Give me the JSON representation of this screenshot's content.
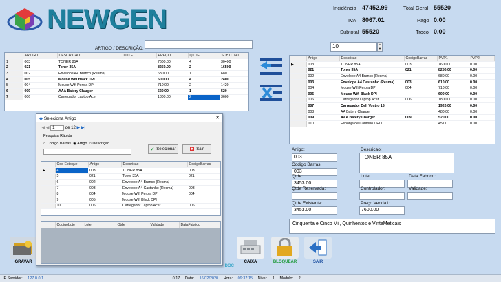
{
  "app": {
    "logo_text": "NEWGEN"
  },
  "summary": {
    "incidencia_label": "Incidência",
    "incidencia_value": "47452.99",
    "iva_label": "IVA",
    "iva_value": "8067.01",
    "subtotal_label": "Subtotal",
    "subtotal_value": "55520",
    "total_geral_label": "Total Geral",
    "total_geral_value": "55520",
    "pago_label": "Pago",
    "pago_value": "0.00",
    "troco_label": "Troco",
    "troco_value": "0.00"
  },
  "search": {
    "label": "ARTIGO / DESCRIÇÃO:",
    "value": ""
  },
  "quantity": {
    "value": "10"
  },
  "cart": {
    "headers": [
      "ARTIGO",
      "DESCRICAO",
      "LOTE",
      "PREÇO",
      "QTDE",
      "SUBTOTAL"
    ],
    "rows": [
      {
        "n": "1",
        "artigo": "003",
        "desc": "TONER 85A",
        "lote": "",
        "preco": "7600.00",
        "qtde": "4",
        "subtotal": "30400",
        "bold": false
      },
      {
        "n": "2",
        "artigo": "021",
        "desc": "Toner 35A",
        "lote": "",
        "preco": "8250.00",
        "qtde": "2",
        "subtotal": "16500",
        "bold": true
      },
      {
        "n": "3",
        "artigo": "002",
        "desc": "Envelope A4 Branco (Resma)",
        "lote": "",
        "preco": "680.00",
        "qtde": "1",
        "subtotal": "680",
        "bold": false
      },
      {
        "n": "4",
        "artigo": "005",
        "desc": "Mouse Wifi Black DPI",
        "lote": "",
        "preco": "600.00",
        "qtde": "4",
        "subtotal": "2400",
        "bold": true
      },
      {
        "n": "5",
        "artigo": "004",
        "desc": "Mouse Wifi Perola DPI",
        "lote": "",
        "preco": "710.00",
        "qtde": "2",
        "subtotal": "1420",
        "bold": false
      },
      {
        "n": "6",
        "artigo": "009",
        "desc": "AAA Batery Charger",
        "lote": "",
        "preco": "520.00",
        "qtde": "1",
        "subtotal": "520",
        "bold": true
      },
      {
        "n": "7",
        "artigo": "006",
        "desc": "Carregador Laptop Acer",
        "lote": "",
        "preco": "1800.00",
        "qtde": "2",
        "subtotal": "3600",
        "bold": false
      }
    ]
  },
  "catalog": {
    "headers": [
      "Artigo",
      "Descricao",
      "CodigoBarras",
      "PVP1",
      "PVP2"
    ],
    "rows": [
      {
        "artigo": "003",
        "desc": "TONER 85A",
        "cod": "003",
        "pvp1": "7600.00",
        "pvp2": "0.00",
        "bold": false
      },
      {
        "artigo": "021",
        "desc": "Toner 35A",
        "cod": "021",
        "pvp1": "8250.00",
        "pvp2": "0.00",
        "bold": true
      },
      {
        "artigo": "002",
        "desc": "Envelope A4 Branco (Resma)",
        "cod": "",
        "pvp1": "680.00",
        "pvp2": "0.00",
        "bold": false
      },
      {
        "artigo": "003",
        "desc": "Envelope A4 Castanho (Resma)",
        "cod": "003",
        "pvp1": "610.00",
        "pvp2": "0.00",
        "bold": true
      },
      {
        "artigo": "004",
        "desc": "Mouse Wifi Perola DPI",
        "cod": "004",
        "pvp1": "710.00",
        "pvp2": "0.00",
        "bold": false
      },
      {
        "artigo": "005",
        "desc": "Mouse Wifi Black DPI",
        "cod": "",
        "pvp1": "600.00",
        "pvp2": "0.00",
        "bold": true
      },
      {
        "artigo": "006",
        "desc": "Carregador Laptop Acer",
        "cod": "006",
        "pvp1": "1800.00",
        "pvp2": "0.00",
        "bold": false
      },
      {
        "artigo": "007",
        "desc": "Carregador Dell Vostro 15",
        "cod": "",
        "pvp1": "1920.00",
        "pvp2": "0.00",
        "bold": true
      },
      {
        "artigo": "008",
        "desc": "AA Batery Charger",
        "cod": "",
        "pvp1": "480.00",
        "pvp2": "0.00",
        "bold": false
      },
      {
        "artigo": "009",
        "desc": "AAA Batery Charger",
        "cod": "009",
        "pvp1": "520.00",
        "pvp2": "0.00",
        "bold": true
      },
      {
        "artigo": "010",
        "desc": "Esponja de Carimbo DELI",
        "cod": "",
        "pvp1": "45.00",
        "pvp2": "0.00",
        "bold": false
      }
    ]
  },
  "details": {
    "artigo_label": "Artigo:",
    "artigo_value": "003",
    "codbarras_label": "Codigo Barras:",
    "codbarras_value": "003",
    "qtde_label": "Qtde:",
    "qtde_value": "3453.00",
    "qtde_reservada_label": "Qtde Reservada:",
    "qtde_reservada_value": "",
    "qtde_existente_label": "Qtde Existente:",
    "qtde_existente_value": "3453.00",
    "descricao_label": "Descricao:",
    "descricao_value": "TONER 85A",
    "lote_label": "Lote:",
    "lote_value": "",
    "data_fabrico_label": "Data Fabrico:",
    "data_fabrico_value": "",
    "controlador_label": "Controlador:",
    "controlador_value": "",
    "validade_label": "Validade:",
    "validade_value": "",
    "preco_venda_label": "Preço Venda1:",
    "preco_venda_value": "7600.00",
    "extenso": "Cinquenta e Cinco Mil, Quinhentos e VinteMeticais"
  },
  "dialog": {
    "title": "Seleciona Artigo",
    "page_current": "1",
    "page_total": "de 12",
    "pesquisa_label": "Pesquisa Rápida",
    "radio_codigo": "Código Barras",
    "radio_artigo": "Artigo",
    "radio_descricao": "Descrição",
    "search_value": "",
    "selecionar_label": "Selecionar",
    "sair_label": "Sair",
    "grid_headers": [
      "Cod Estoque",
      "Artigo",
      "Descricao",
      "CodigoBarras"
    ],
    "grid_rows": [
      {
        "cod": "4",
        "artigo": "003",
        "desc": "TONER 85A",
        "barras": "003"
      },
      {
        "cod": "5",
        "artigo": "021",
        "desc": "Toner 35A",
        "barras": "021"
      },
      {
        "cod": "6",
        "artigo": "002",
        "desc": "Envelope A4 Branco (Resma)",
        "barras": ""
      },
      {
        "cod": "7",
        "artigo": "003",
        "desc": "Envelope A4 Castanho (Resma)",
        "barras": "003"
      },
      {
        "cod": "8",
        "artigo": "004",
        "desc": "Mouse Wifi Perola DPI",
        "barras": "004"
      },
      {
        "cod": "9",
        "artigo": "005",
        "desc": "Mouse Wifi Black DPI",
        "barras": ""
      },
      {
        "cod": "10",
        "artigo": "006",
        "desc": "Carregador Laptop Acer",
        "barras": "006"
      }
    ],
    "lot_headers": [
      "CodigoLote",
      "Lote",
      "Qtde",
      "Validade",
      "DataFabrico"
    ]
  },
  "buttons": {
    "gravar": "GRAVAR",
    "doc": "DOC",
    "caixa": "CAIXA",
    "bloquear": "BLOQUEAR",
    "sair": "SAIR"
  },
  "status": {
    "ip_label": "IP Servidor:",
    "ip_value": "127.0.0.1",
    "ip_extra": "0.17",
    "data_label": "Data:",
    "data_value": "16/02/2020",
    "hora_label": "Hora:",
    "hora_value": "09:37:15",
    "nivel_label": "Nivel:",
    "nivel_value": "1",
    "modulo_label": "Modulo:",
    "modulo_value": "2"
  },
  "colors": {
    "background": "#c7daf0",
    "logo": "#1e7f9c",
    "selected": "#0a64c8",
    "status_blue": "#1c5bb3"
  }
}
